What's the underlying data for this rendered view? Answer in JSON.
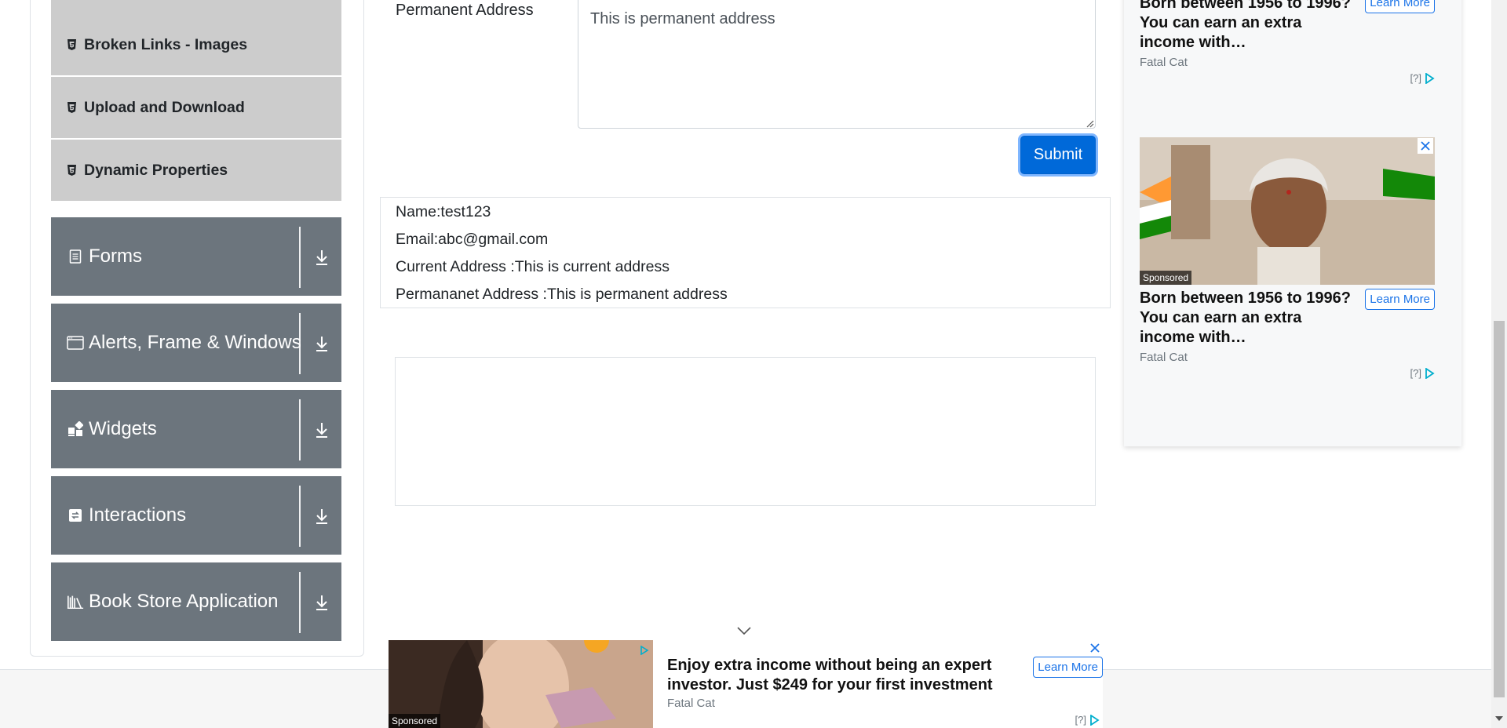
{
  "sidebar": {
    "sub_items": [
      {
        "label": "Broken Links - Images",
        "icon": "html5-icon"
      },
      {
        "label": "Upload and Download",
        "icon": "html5-icon"
      },
      {
        "label": "Dynamic Properties",
        "icon": "html5-icon"
      }
    ],
    "groups": [
      {
        "label": "Forms",
        "icon": "document-icon"
      },
      {
        "label": "Alerts, Frame & Windows",
        "icon": "window-icon"
      },
      {
        "label": "Widgets",
        "icon": "widgets-icon"
      },
      {
        "label": "Interactions",
        "icon": "interactions-icon"
      },
      {
        "label": "Book Store Application",
        "icon": "books-icon"
      }
    ]
  },
  "form": {
    "permanent_address_label": "Permanent Address",
    "permanent_address_value": "This is permanent address",
    "submit_label": "Submit"
  },
  "output": {
    "name": "Name:test123",
    "email": "Email:abc@gmail.com",
    "current_address": "Current Address :This is current address",
    "permanent_address": "Permananet Address :This is permanent address"
  },
  "right_ads": {
    "top": {
      "title": "Born between 1956 to 1996? You can earn an extra income with…",
      "brand": "Fatal Cat",
      "learn_more": "Learn More",
      "adchoice": "[?]"
    },
    "bottom": {
      "sponsored": "Sponsored",
      "title": "Born between 1956 to 1996? You can earn an extra income with…",
      "brand": "Fatal Cat",
      "learn_more": "Learn More",
      "adchoice": "[?]"
    }
  },
  "bottom_ad": {
    "sponsored": "Sponsored",
    "title": "Enjoy extra income without being an expert investor. Just $249 for your first investment",
    "brand": "Fatal Cat",
    "learn_more": "Learn More",
    "adchoice": "[?]"
  },
  "colors": {
    "sidebar_sub_bg": "#cccccc",
    "sidebar_group_bg": "#6c757d",
    "submit_bg": "#0069d9",
    "ad_accent": "#1a73e8"
  }
}
